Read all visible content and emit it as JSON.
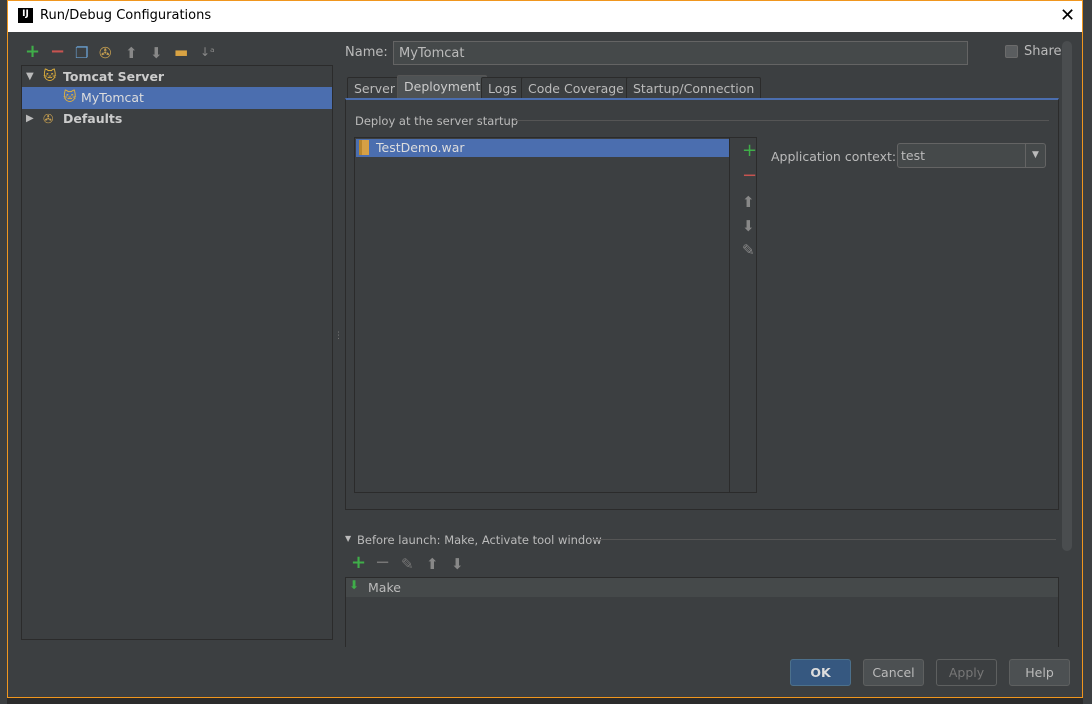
{
  "window": {
    "title": "Run/Debug Configurations",
    "logo": "IJ"
  },
  "toolbar": {
    "icons": [
      "add-icon",
      "remove-icon",
      "copy-icon",
      "wrench-icon",
      "arrow-up-icon",
      "arrow-down-icon",
      "folder-icon",
      "sort-icon"
    ]
  },
  "tree": {
    "items": [
      {
        "label": "Tomcat Server",
        "expanded": true
      },
      {
        "label": "MyTomcat",
        "selected": true
      },
      {
        "label": "Defaults",
        "expanded": false
      }
    ]
  },
  "name_field": {
    "label": "Name:",
    "value": "MyTomcat"
  },
  "share": {
    "label": "Share",
    "checked": false
  },
  "tabs": [
    {
      "label": "Server"
    },
    {
      "label": "Deployment",
      "active": true
    },
    {
      "label": "Logs"
    },
    {
      "label": "Code Coverage"
    },
    {
      "label": "Startup/Connection"
    }
  ],
  "deployment": {
    "section_title": "Deploy at the server startup",
    "artifacts": [
      "TestDemo.war"
    ],
    "app_context_label": "Application context:",
    "app_context_value": "test"
  },
  "before_launch": {
    "title": "Before launch: Make, Activate tool window",
    "tasks": [
      "Make"
    ]
  },
  "buttons": {
    "ok": "OK",
    "cancel": "Cancel",
    "apply": "Apply",
    "help": "Help"
  },
  "colors": {
    "accent": "#4b6eaf",
    "border": "#f0961e",
    "add": "#3fae49",
    "remove": "#c75450"
  }
}
